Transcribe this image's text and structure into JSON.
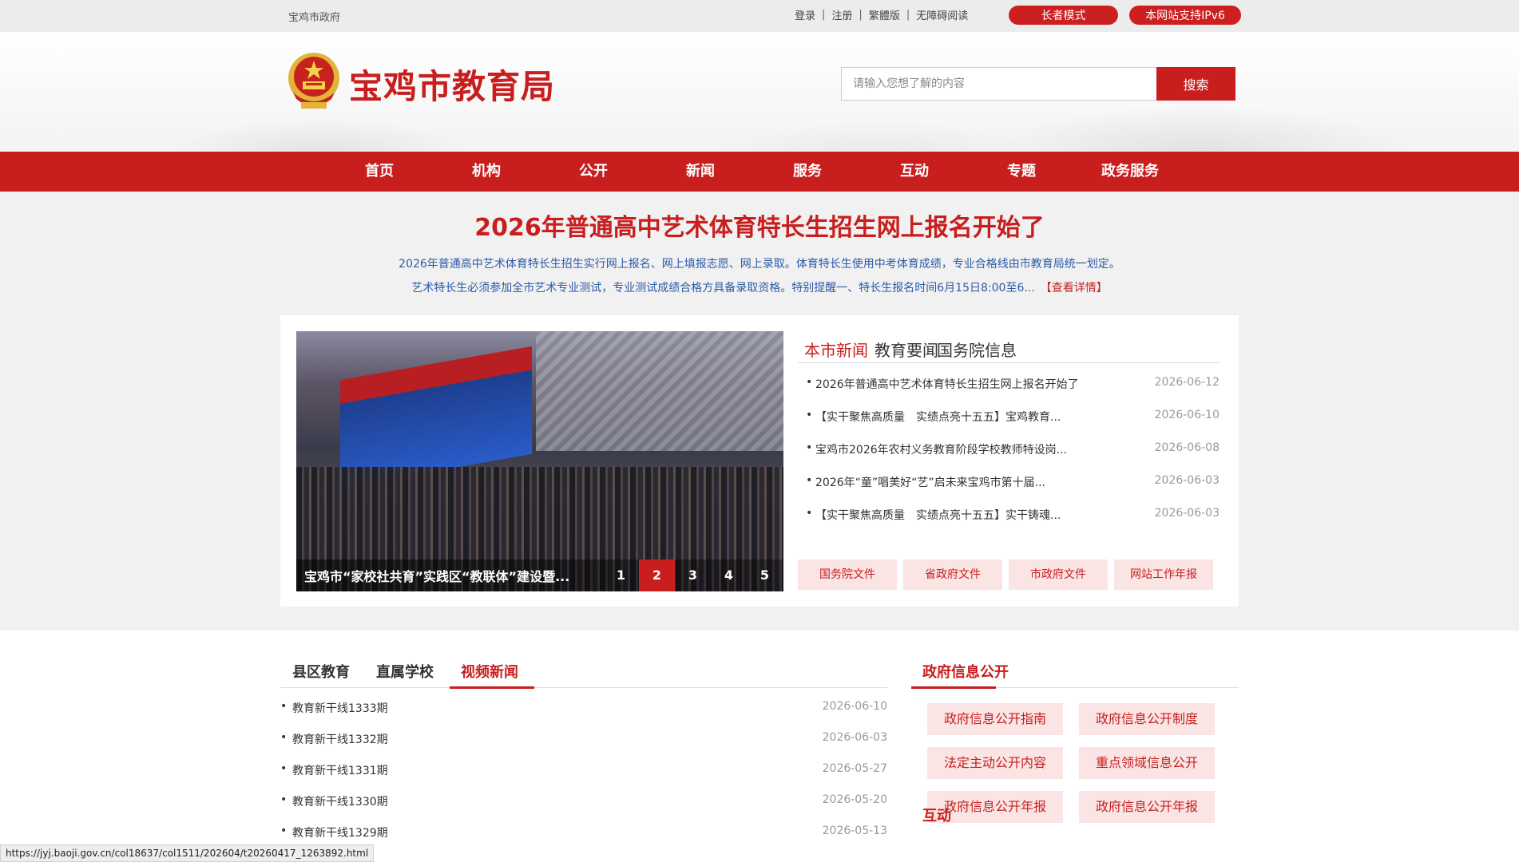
{
  "topbar": {
    "gov_link": "宝鸡市政府",
    "links": [
      "登录",
      "注册",
      "繁體版",
      "无障碍阅读"
    ],
    "elder_mode": "长者模式",
    "ipv6": "本网站支持IPv6"
  },
  "header": {
    "site_name": "宝鸡市教育局",
    "emblem_icon": "national-emblem-icon",
    "search_placeholder": "请输入您想了解的内容",
    "search_button": "搜索"
  },
  "nav": [
    "首页",
    "机构",
    "公开",
    "新闻",
    "服务",
    "互动",
    "专题",
    "政务服务"
  ],
  "headline": {
    "title": "2026年普通高中艺术体育特长生招生网上报名开始了",
    "summary_line1": "2026年普通高中艺术体育特长生招生实行网上报名、网上填报志愿、网上录取。体育特长生使用中考体育成绩，专业合格线由市教育局统一划定。",
    "summary_line2": "艺术特长生必须参加全市艺术专业测试，专业测试成绩合格方具备录取资格。特别提醒一、特长生报名时间6月15日8:00至6...",
    "summary_more": "【查看详情】"
  },
  "slider": {
    "caption": "宝鸡市“家校社共育”实践区“教联体”建设暨...",
    "pages": [
      "1",
      "2",
      "3",
      "4",
      "5"
    ],
    "active_page": 2
  },
  "news": {
    "tabs": [
      "本市新闻",
      "教育要闻",
      "国务院信息"
    ],
    "active_tab": 0,
    "items": [
      {
        "title": "2026年普通高中艺术体育特长生招生网上报名开始了",
        "date": "2026-06-12"
      },
      {
        "title": "【实干聚焦高质量　实绩点亮十五五】宝鸡教育...",
        "date": "2026-06-10"
      },
      {
        "title": "宝鸡市2026年农村义务教育阶段学校教师特设岗...",
        "date": "2026-06-08"
      },
      {
        "title": "2026年“童”唱美好“艺”启未来宝鸡市第十届...",
        "date": "2026-06-03"
      },
      {
        "title": "【实干聚焦高质量　实绩点亮十五五】实干铸魂...",
        "date": "2026-06-03"
      }
    ],
    "doc_buttons": [
      "国务院文件",
      "省政府文件",
      "市政府文件",
      "网站工作年报"
    ]
  },
  "lower": {
    "tabs": [
      "县区教育",
      "直属学校",
      "视频新闻"
    ],
    "active_tab": 2,
    "videos": [
      {
        "title": "教育新干线1333期",
        "date": "2026-06-10"
      },
      {
        "title": "教育新干线1332期",
        "date": "2026-06-03"
      },
      {
        "title": "教育新干线1331期",
        "date": "2026-05-27"
      },
      {
        "title": "教育新干线1330期",
        "date": "2026-05-20"
      },
      {
        "title": "教育新干线1329期",
        "date": "2026-05-13"
      }
    ],
    "gov_title": "政府信息公开",
    "gov_buttons": [
      "政府信息公开指南",
      "政府信息公开制度",
      "法定主动公开内容",
      "重点领域信息公开",
      "政府信息公开年报",
      "政府信息公开年报"
    ],
    "hudong_title": "互动"
  },
  "status_url": "https://jyj.baoji.gov.cn/col18637/col1511/202604/t20260417_1263892.html",
  "colors": {
    "brand_red": "#c81e1e",
    "light_red_bg": "#fbe4e4",
    "summary_blue": "#2d5aa8"
  }
}
